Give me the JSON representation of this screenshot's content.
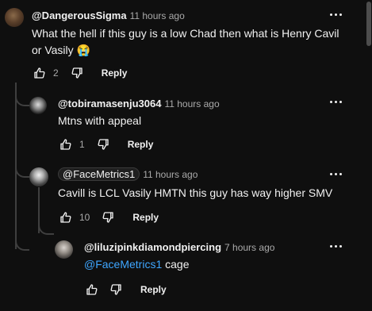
{
  "comments": [
    {
      "author": "@DangerousSigma",
      "time": "11 hours ago",
      "text": "What the hell if this guy is a low Chad then what is Henry Cavil or Vasily",
      "emoji": "😭",
      "likes": "2",
      "reply_label": "Reply"
    },
    {
      "author": "@tobiramasenju3064",
      "time": "11 hours ago",
      "text": "Mtns with appeal",
      "likes": "1",
      "reply_label": "Reply"
    },
    {
      "author": "@FaceMetrics1",
      "time": "11 hours ago",
      "text": "Cavill is LCL Vasily HMTN this guy has way higher SMV",
      "likes": "10",
      "reply_label": "Reply"
    },
    {
      "author": "@liluzipinkdiamondpiercing",
      "time": "7 hours ago",
      "mention": "@FaceMetrics1",
      "text": " cage",
      "likes": "",
      "reply_label": "Reply"
    }
  ],
  "icons": {
    "like": "thumbs-up-icon",
    "dislike": "thumbs-down-icon",
    "more": "more-vertical-icon"
  },
  "colors": {
    "background": "#0f0f0f",
    "text": "#f1f1f1",
    "secondary": "#aaaaaa",
    "mention": "#3ea6ff"
  }
}
